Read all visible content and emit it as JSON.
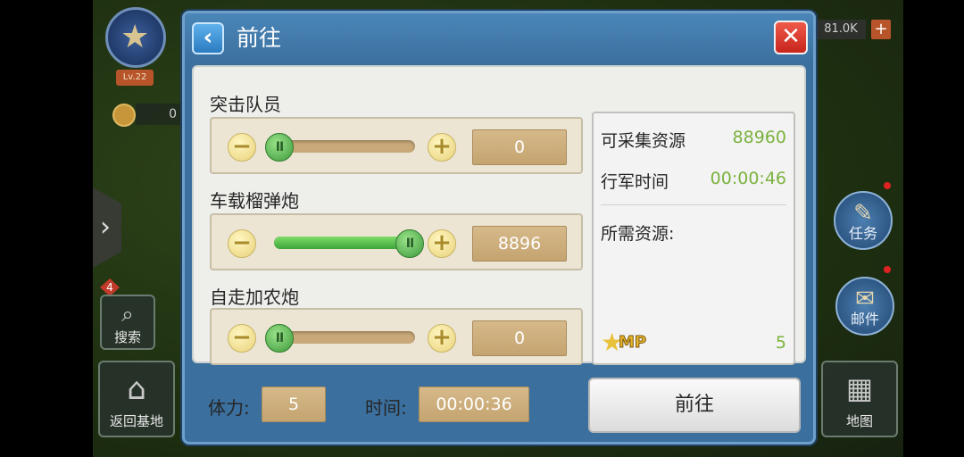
{
  "background_hud": {
    "level": "Lv.22",
    "coin_value": "0",
    "resource_value": "81.0K",
    "plus_label": "+",
    "badge_count": "4",
    "search_label": "搜索",
    "return_base_label": "返回基地",
    "tasks_label": "任务",
    "mail_label": "邮件",
    "map_label": "地图"
  },
  "dialog": {
    "title": "前往",
    "back_icon": "‹",
    "close_icon": "✕"
  },
  "troops": [
    {
      "label": "突击队员",
      "value": "0",
      "slider_fraction": 0.0
    },
    {
      "label": "车载榴弹炮",
      "value": "8896",
      "slider_fraction": 1.0
    },
    {
      "label": "自走加农炮",
      "value": "0",
      "slider_fraction": 0.0
    }
  ],
  "step_buttons": {
    "minus": "−",
    "plus": "+"
  },
  "knob_glyph": "II",
  "info": {
    "collectable_label": "可采集资源",
    "collectable_value": "88960",
    "march_time_label": "行军时间",
    "march_time_value": "00:00:46",
    "required_label": "所需资源:",
    "mp_label": "MP",
    "mp_value": "5"
  },
  "footer": {
    "stamina_label": "体力:",
    "stamina_value": "5",
    "time_label": "时间:",
    "time_value": "00:00:36",
    "go_button_label": "前往"
  },
  "colors": {
    "dialog_blue": "#3a6f9e",
    "accent_green": "#7bb23e",
    "value_box_tan": "#c4a470",
    "close_red": "#c8241c"
  }
}
